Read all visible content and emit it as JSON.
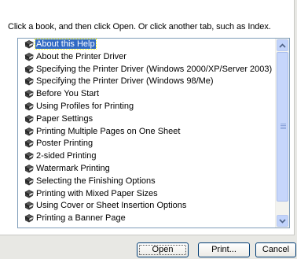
{
  "instruction": "Click a book, and then click Open. Or click another tab, such as Index.",
  "topics": [
    {
      "label": "About this Help",
      "selected": true
    },
    {
      "label": "About the Printer Driver"
    },
    {
      "label": "Specifying the Printer Driver (Windows 2000/XP/Server 2003)"
    },
    {
      "label": "Specifying the Printer Driver (Windows 98/Me)"
    },
    {
      "label": "Before You Start"
    },
    {
      "label": "Using Profiles for Printing"
    },
    {
      "label": "Paper Settings"
    },
    {
      "label": "Printing Multiple Pages on One Sheet"
    },
    {
      "label": "Poster Printing"
    },
    {
      "label": "2-sided Printing"
    },
    {
      "label": "Watermark Printing"
    },
    {
      "label": "Selecting the Finishing Options"
    },
    {
      "label": "Printing with Mixed Paper Sizes"
    },
    {
      "label": "Using Cover or Sheet Insertion Options"
    },
    {
      "label": "Printing a Banner Page"
    }
  ],
  "topic_icon": "closed-book-icon",
  "buttons": {
    "open": "Open",
    "print": "Print...",
    "cancel": "Cancel"
  },
  "colors": {
    "selection": "#316ac5",
    "scrollbar": "#c1d3fb",
    "panel": "#ffffff"
  }
}
